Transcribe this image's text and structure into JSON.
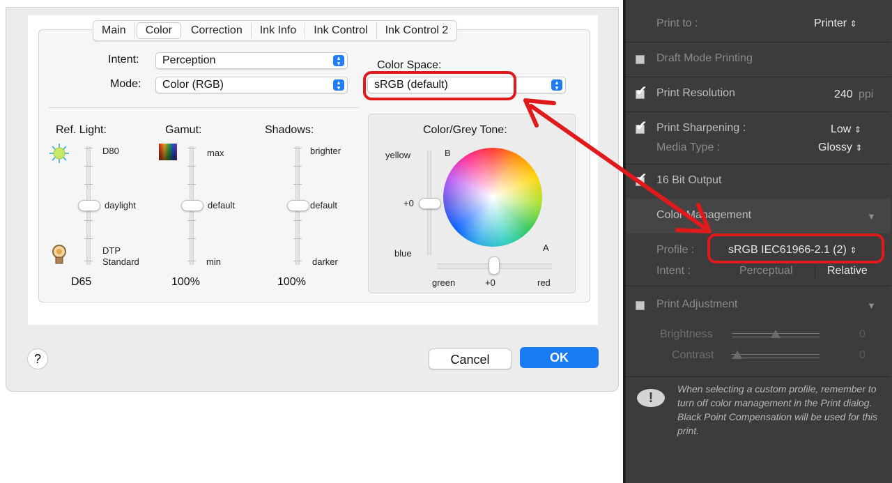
{
  "dialog": {
    "tabs": [
      "Main",
      "Color",
      "Correction",
      "Ink Info",
      "Ink Control",
      "Ink Control 2"
    ],
    "active_tab": "Color",
    "intent_label": "Intent:",
    "intent_value": "Perception",
    "mode_label": "Mode:",
    "mode_value": "Color (RGB)",
    "color_space_label": "Color Space:",
    "color_space_value": "sRGB (default)",
    "ref_light": {
      "title": "Ref. Light:",
      "top": "D80",
      "mid": "daylight",
      "bottom_1": "DTP",
      "bottom_2": "Standard",
      "value": "D65"
    },
    "gamut": {
      "title": "Gamut:",
      "top": "max",
      "mid": "default",
      "bottom": "min",
      "value": "100%"
    },
    "shadows": {
      "title": "Shadows:",
      "top": "brighter",
      "mid": "default",
      "bottom": "darker",
      "value": "100%"
    },
    "tone": {
      "title": "Color/Grey Tone:",
      "yellow": "yellow",
      "b": "B",
      "plus0": "+0",
      "blue": "blue",
      "a": "A",
      "green": "green",
      "plus0_x": "+0",
      "red": "red"
    },
    "help": "?",
    "cancel": "Cancel",
    "ok": "OK"
  },
  "lightroom": {
    "print_to_label": "Print to :",
    "print_to_value": "Printer",
    "draft_mode": "Draft Mode Printing",
    "draft_checked": false,
    "print_resolution": "Print Resolution",
    "resolution_value": "240",
    "resolution_unit": "ppi",
    "print_sharpening": "Print Sharpening :",
    "sharpening_value": "Low",
    "media_type": "Media Type :",
    "media_value": "Glossy",
    "bit_output": "16 Bit Output",
    "color_management": "Color Management",
    "profile_label": "Profile :",
    "profile_value": "sRGB IEC61966-2.1 (2)",
    "intent_label": "Intent :",
    "intent_perceptual": "Perceptual",
    "intent_relative": "Relative",
    "print_adjustment": "Print Adjustment",
    "brightness_label": "Brightness",
    "brightness_value": "0",
    "contrast_label": "Contrast",
    "contrast_value": "0",
    "notice": "When selecting a custom profile, remember to turn off color management in the Print dialog. Black Point Compensation will be used for this print.",
    "stepper_symbol": "⇕"
  },
  "colors": {
    "accent": "#1a7cf5",
    "annotation": "#e01a1a",
    "lr_bg": "#3c3c3c"
  }
}
